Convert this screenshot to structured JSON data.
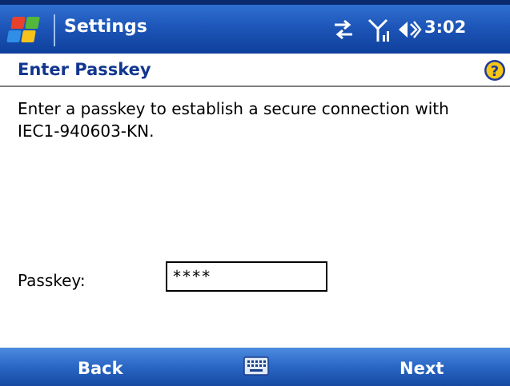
{
  "titlebar": {
    "title": "Settings",
    "clock": "3:02",
    "icons": [
      "windows-start-icon",
      "connectivity-icon",
      "signal-icon",
      "volume-icon"
    ]
  },
  "page": {
    "title": "Enter Passkey",
    "help_icon": "help-icon",
    "description": "Enter a passkey to establish a secure connection with IEC1-940603-KN."
  },
  "form": {
    "passkey_label": "Passkey:",
    "passkey_value": "****"
  },
  "softkeys": {
    "left": "Back",
    "right": "Next",
    "center_icon": "keyboard-icon"
  },
  "colors": {
    "titlebar": "#1d56b8",
    "title_text": "#12368f",
    "softbar": "#2a66c4"
  }
}
